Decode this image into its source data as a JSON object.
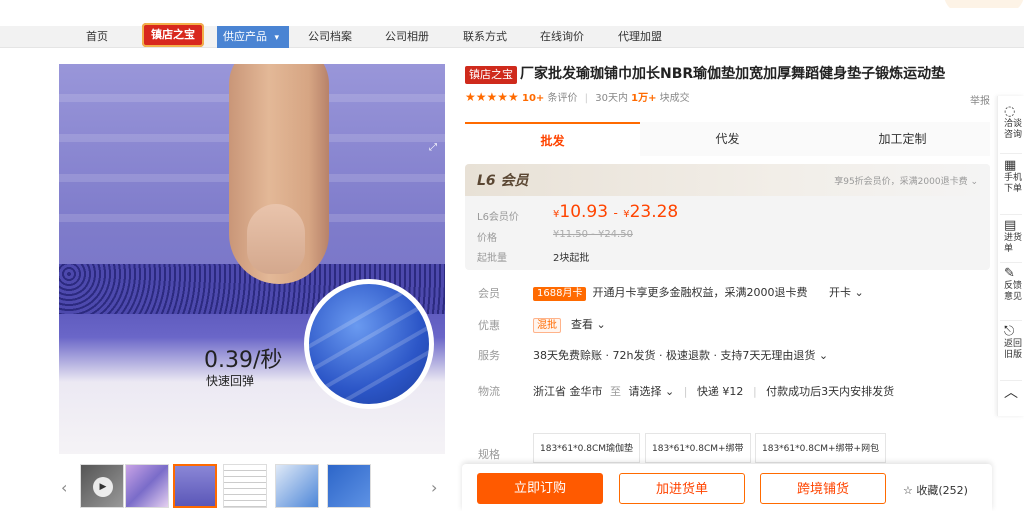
{
  "nav": {
    "home": "首页",
    "badge": "镇店之宝",
    "supply": "供应产品",
    "supply_caret": "▾",
    "archive": "公司档案",
    "album": "公司相册",
    "contact": "联系方式",
    "inquiry": "在线询价",
    "agent": "代理加盟"
  },
  "gallery": {
    "speed": "0.39/秒",
    "speed_label": "快速回弹",
    "prev": "‹",
    "next": "›"
  },
  "product": {
    "tag": "镇店之宝",
    "title": "厂家批发瑜珈铺巾加长NBR瑜伽垫加宽加厚舞蹈健身垫子锻炼运动垫",
    "stars": "★★★★★",
    "reviews_count": "10+",
    "reviews_label": "条评价",
    "deals_prefix": "30天内",
    "deals_count": "1万+",
    "deals_suffix": "块成交",
    "report": "举报"
  },
  "tabs": {
    "wholesale": "批发",
    "dropship": "代发",
    "custom": "加工定制"
  },
  "price": {
    "level": "L6 会员",
    "vip_note": "享95折会员价，采满2000退卡费",
    "vip_label": "L6会员价",
    "currency": "¥",
    "low": "10.93",
    "dash": "-",
    "high": "23.28",
    "orig_label": "价格",
    "orig_range": "¥11.50 - ¥24.50",
    "moq_label": "起批量",
    "moq_value": "2块起批"
  },
  "member": {
    "label": "会员",
    "tag": "1688月卡",
    "text": "开通月卡享更多金融权益，采满2000退卡费",
    "action": "开卡"
  },
  "discount": {
    "label": "优惠",
    "tag": "混批",
    "action": "查看"
  },
  "service": {
    "label": "服务",
    "text": "38天免费赊账 · 72h发货 · 极速退款 · 支持7天无理由退货"
  },
  "logistics": {
    "label": "物流",
    "from": "浙江省 金华市",
    "to_word": "至",
    "to": "请选择",
    "express": "快递 ¥12",
    "ship_note": "付款成功后3天内安排发货"
  },
  "spec": {
    "label": "规格",
    "options": [
      "183*61*0.8CM瑜伽垫",
      "183*61*0.8CM+绑带",
      "183*61*0.8CM+绑带+网包"
    ]
  },
  "actions": {
    "buy": "立即订购",
    "cart": "加进货单",
    "crossborder": "跨境铺货",
    "fav_icon": "☆",
    "fav": "收藏(252)"
  },
  "sidebar": {
    "consult": "洽谈咨询",
    "mobile": "手机下单",
    "stock": "进货单",
    "feedback": "反馈意见",
    "back": "返回旧版"
  },
  "colors": {
    "accent": "#ff6a00",
    "price": "#ff4400",
    "badge": "#d8281d",
    "supply": "#4a84d3"
  }
}
